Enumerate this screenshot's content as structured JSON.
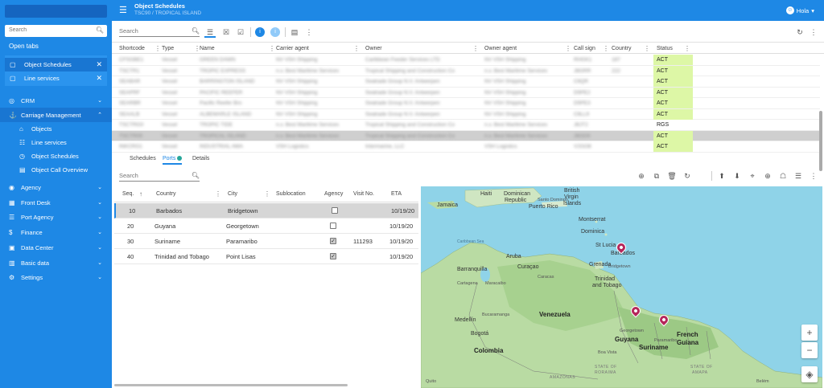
{
  "sidebar": {
    "search_placeholder": "Search",
    "open_tabs_label": "Open tabs",
    "open_tabs": [
      {
        "label": "Object Schedules",
        "icon": "window-icon"
      },
      {
        "label": "Line services",
        "icon": "window-icon"
      }
    ],
    "nav": {
      "crm": "CRM",
      "carriage": "Carriage Management",
      "carriage_items": [
        "Objects",
        "Line services",
        "Object Schedules",
        "Object Call Overview"
      ],
      "agency": "Agency",
      "front_desk": "Front Desk",
      "port_agency": "Port Agency",
      "finance": "Finance",
      "data_center": "Data Center",
      "basic_data": "Basic data",
      "settings": "Settings"
    }
  },
  "topbar": {
    "title": "Object Schedules",
    "subtitle": "TSC90 / TROPICAL ISLAND",
    "user_name": "Hola"
  },
  "toolbar": {
    "search_placeholder": "Search"
  },
  "grid": {
    "columns": [
      "Shortcode",
      "Type",
      "Name",
      "Carrier agent",
      "Owner",
      "Owner agent",
      "Call sign",
      "Country",
      "Status"
    ],
    "rows": [
      {
        "shortcode": "CFSGBE1",
        "type": "Vessel",
        "name": "GREEN DAWN",
        "carrier": "NV VSH Shipping",
        "owner": "Caribbean Feeder Services LTD",
        "owner_agent": "NV VSH Shipping",
        "call_sign": "RHGK1",
        "country": "187",
        "status": "ACT"
      },
      {
        "shortcode": "TSCTR1",
        "type": "Vessel",
        "name": "TROPIC EXPRESS",
        "carrier": "n.v. Best Maritime Services",
        "owner": "Tropical Shipping and Construction Co",
        "owner_agent": "n.v. Best Maritime Services",
        "call_sign": "J8GRR",
        "country": "222",
        "status": "ACT"
      },
      {
        "shortcode": "SEABAR",
        "type": "Vessel",
        "name": "BARRINGTON ISLAND",
        "carrier": "NV VSH Shipping",
        "owner": "Seatrade Group N.V. Antwerpen",
        "owner_agent": "NV VSH Shipping",
        "call_sign": "C6QR",
        "country": "",
        "status": "ACT"
      },
      {
        "shortcode": "SEAPRF",
        "type": "Vessel",
        "name": "PACIFIC REEFER",
        "carrier": "NV VSH Shipping",
        "owner": "Seatrade Group N.V. Antwerpen",
        "owner_agent": "NV VSH Shipping",
        "call_sign": "D5PE2",
        "country": "",
        "status": "ACT"
      },
      {
        "shortcode": "SEARBR",
        "type": "Vessel",
        "name": "Pacific Reefer Bro",
        "carrier": "NV VSH Shipping",
        "owner": "Seatrade Group N.V. Antwerpen",
        "owner_agent": "NV VSH Shipping",
        "call_sign": "D5PE3",
        "country": "",
        "status": "ACT"
      },
      {
        "shortcode": "SEAALB",
        "type": "Vessel",
        "name": "ALBEMARLE ISLAND",
        "carrier": "NV VSH Shipping",
        "owner": "Seatrade Group N.V. Antwerpen",
        "owner_agent": "NV VSH Shipping",
        "call_sign": "C6LL9",
        "country": "",
        "status": "ACT"
      },
      {
        "shortcode": "TSCTRG0",
        "type": "Vessel",
        "name": "TROPIC TIDE",
        "carrier": "n.v. Best Maritime Services",
        "owner": "Tropical Shipping and Construction Co",
        "owner_agent": "n.v. Best Maritime Services",
        "call_sign": "J8JT2",
        "country": "",
        "status": "RGS"
      },
      {
        "shortcode": "TSCTR09",
        "type": "Vessel",
        "name": "TROPICAL ISLAND",
        "carrier": "n.v. Best Maritime Services",
        "owner": "Tropical Shipping and Construction Co",
        "owner_agent": "n.v. Best Maritime Services",
        "call_sign": "J8GD9",
        "country": "",
        "status": "ACT"
      },
      {
        "shortcode": "INKCRG1",
        "type": "Vessel",
        "name": "INDUSTRIAL AMA",
        "carrier": "VSH Logistics",
        "owner": "Intermarine, LLC",
        "owner_agent": "VSH Logistics",
        "call_sign": "V2GO8",
        "country": "",
        "status": "ACT"
      }
    ]
  },
  "subtabs": [
    "Schedules",
    "Ports",
    "Details"
  ],
  "ports_search_placeholder": "Search",
  "ports": {
    "columns": [
      "Seq.",
      "Country",
      "City",
      "Sublocation",
      "Agency",
      "Visit No.",
      "ETA"
    ],
    "rows": [
      {
        "seq": "10",
        "country": "Barbados",
        "city": "Bridgetown",
        "sublocation": "",
        "agency": false,
        "visit": "",
        "eta": "10/19/20"
      },
      {
        "seq": "20",
        "country": "Guyana",
        "city": "Georgetown",
        "sublocation": "",
        "agency": false,
        "visit": "",
        "eta": "10/19/20"
      },
      {
        "seq": "30",
        "country": "Suriname",
        "city": "Paramaribo",
        "sublocation": "",
        "agency": true,
        "visit": "111293",
        "eta": "10/19/20"
      },
      {
        "seq": "40",
        "country": "Trinidad and Tobago",
        "city": "Point Lisas",
        "sublocation": "",
        "agency": true,
        "visit": "",
        "eta": "10/19/20"
      }
    ]
  },
  "map": {
    "labels": {
      "haiti": "Haiti",
      "dominican": "Dominican",
      "republic": "Republic",
      "santo_domingo": "Santo Domingo",
      "puerto_rico": "Puerto Rico",
      "bvi1": "British",
      "bvi2": "Virgin",
      "bvi3": "Islands",
      "jamaica": "Jamaica",
      "montserrat": "Montserrat",
      "dominica": "Dominica",
      "caribbean_sea": "Caribbean Sea",
      "st_lucia": "St Lucia",
      "barbados": "Barbados",
      "bridgetown": "Bridgetown",
      "grenada": "Grenada",
      "aruba": "Aruba",
      "curacao": "Curaçao",
      "barranquilla": "Barranquilla",
      "cartagena": "Cartagena",
      "caracas": "Caracas",
      "trinidad1": "Trinidad",
      "trinidad2": "and Tobago",
      "maracaibo": "Maracaibo",
      "medellin": "Medellín",
      "bucaramanga": "Bucaramanga",
      "venezuela": "Venezuela",
      "bogota": "Bogotá",
      "colombia": "Colombia",
      "georgetown": "Georgetown",
      "guyana": "Guyana",
      "paramaribo": "Paramaribo",
      "suriname": "Suriname",
      "french1": "French",
      "french2": "Guiana",
      "boa_vista": "Boa Vista",
      "roraima1": "STATE OF",
      "roraima2": "RORAIMA",
      "amapa1": "STATE OF",
      "amapa2": "AMAPA",
      "amazonas": "AMAZONAS",
      "quito": "Quito",
      "belem": "Belém"
    }
  }
}
